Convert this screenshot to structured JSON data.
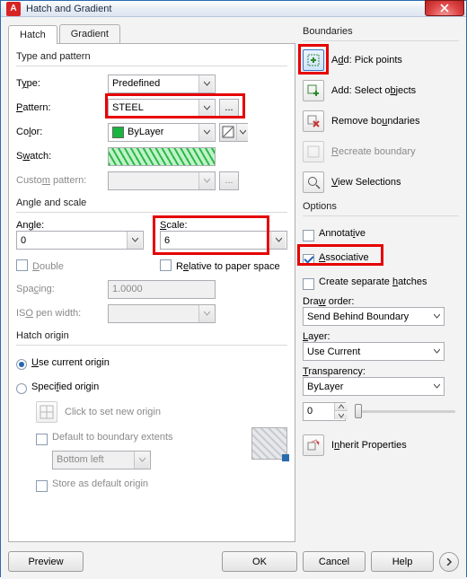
{
  "window": {
    "title": "Hatch and Gradient"
  },
  "tabs": {
    "hatch": "Hatch",
    "gradient": "Gradient"
  },
  "group": {
    "type_pattern": "Type and pattern",
    "angle_scale": "Angle and scale",
    "hatch_origin": "Hatch origin"
  },
  "labels": {
    "type": "Type:",
    "pattern": "Pattern:",
    "color": "Color:",
    "swatch": "Swatch:",
    "custom_pattern": "Custom pattern:",
    "angle": "Angle:",
    "scale": "Scale:",
    "double": "Double",
    "relative": "Relative to paper space",
    "spacing": "Spacing:",
    "iso_pen": "ISO pen width:"
  },
  "values": {
    "type": "Predefined",
    "pattern": "STEEL",
    "color": "ByLayer",
    "angle": "0",
    "scale": "6",
    "spacing": "1.0000",
    "iso_pen": ""
  },
  "origin": {
    "use_current": "Use current origin",
    "specified": "Specified origin",
    "click_new": "Click to set new origin",
    "default_extents": "Default to boundary extents",
    "bottom_left": "Bottom left",
    "store_default": "Store as default origin"
  },
  "boundaries": {
    "title": "Boundaries",
    "add_pick": "Add: Pick points",
    "add_select": "Add: Select objects",
    "remove": "Remove boundaries",
    "recreate": "Recreate boundary",
    "view_sel": "View Selections"
  },
  "options": {
    "title": "Options",
    "annotative": "Annotative",
    "associative": "Associative",
    "separate": "Create separate hatches",
    "draw_order_lbl": "Draw order:",
    "draw_order": "Send Behind Boundary",
    "layer_lbl": "Layer:",
    "layer": "Use Current",
    "transparency_lbl": "Transparency:",
    "transparency": "ByLayer",
    "transparency_val": "0",
    "inherit": "Inherit Properties"
  },
  "buttons": {
    "preview": "Preview",
    "ok": "OK",
    "cancel": "Cancel",
    "help": "Help",
    "ellipsis": "..."
  }
}
